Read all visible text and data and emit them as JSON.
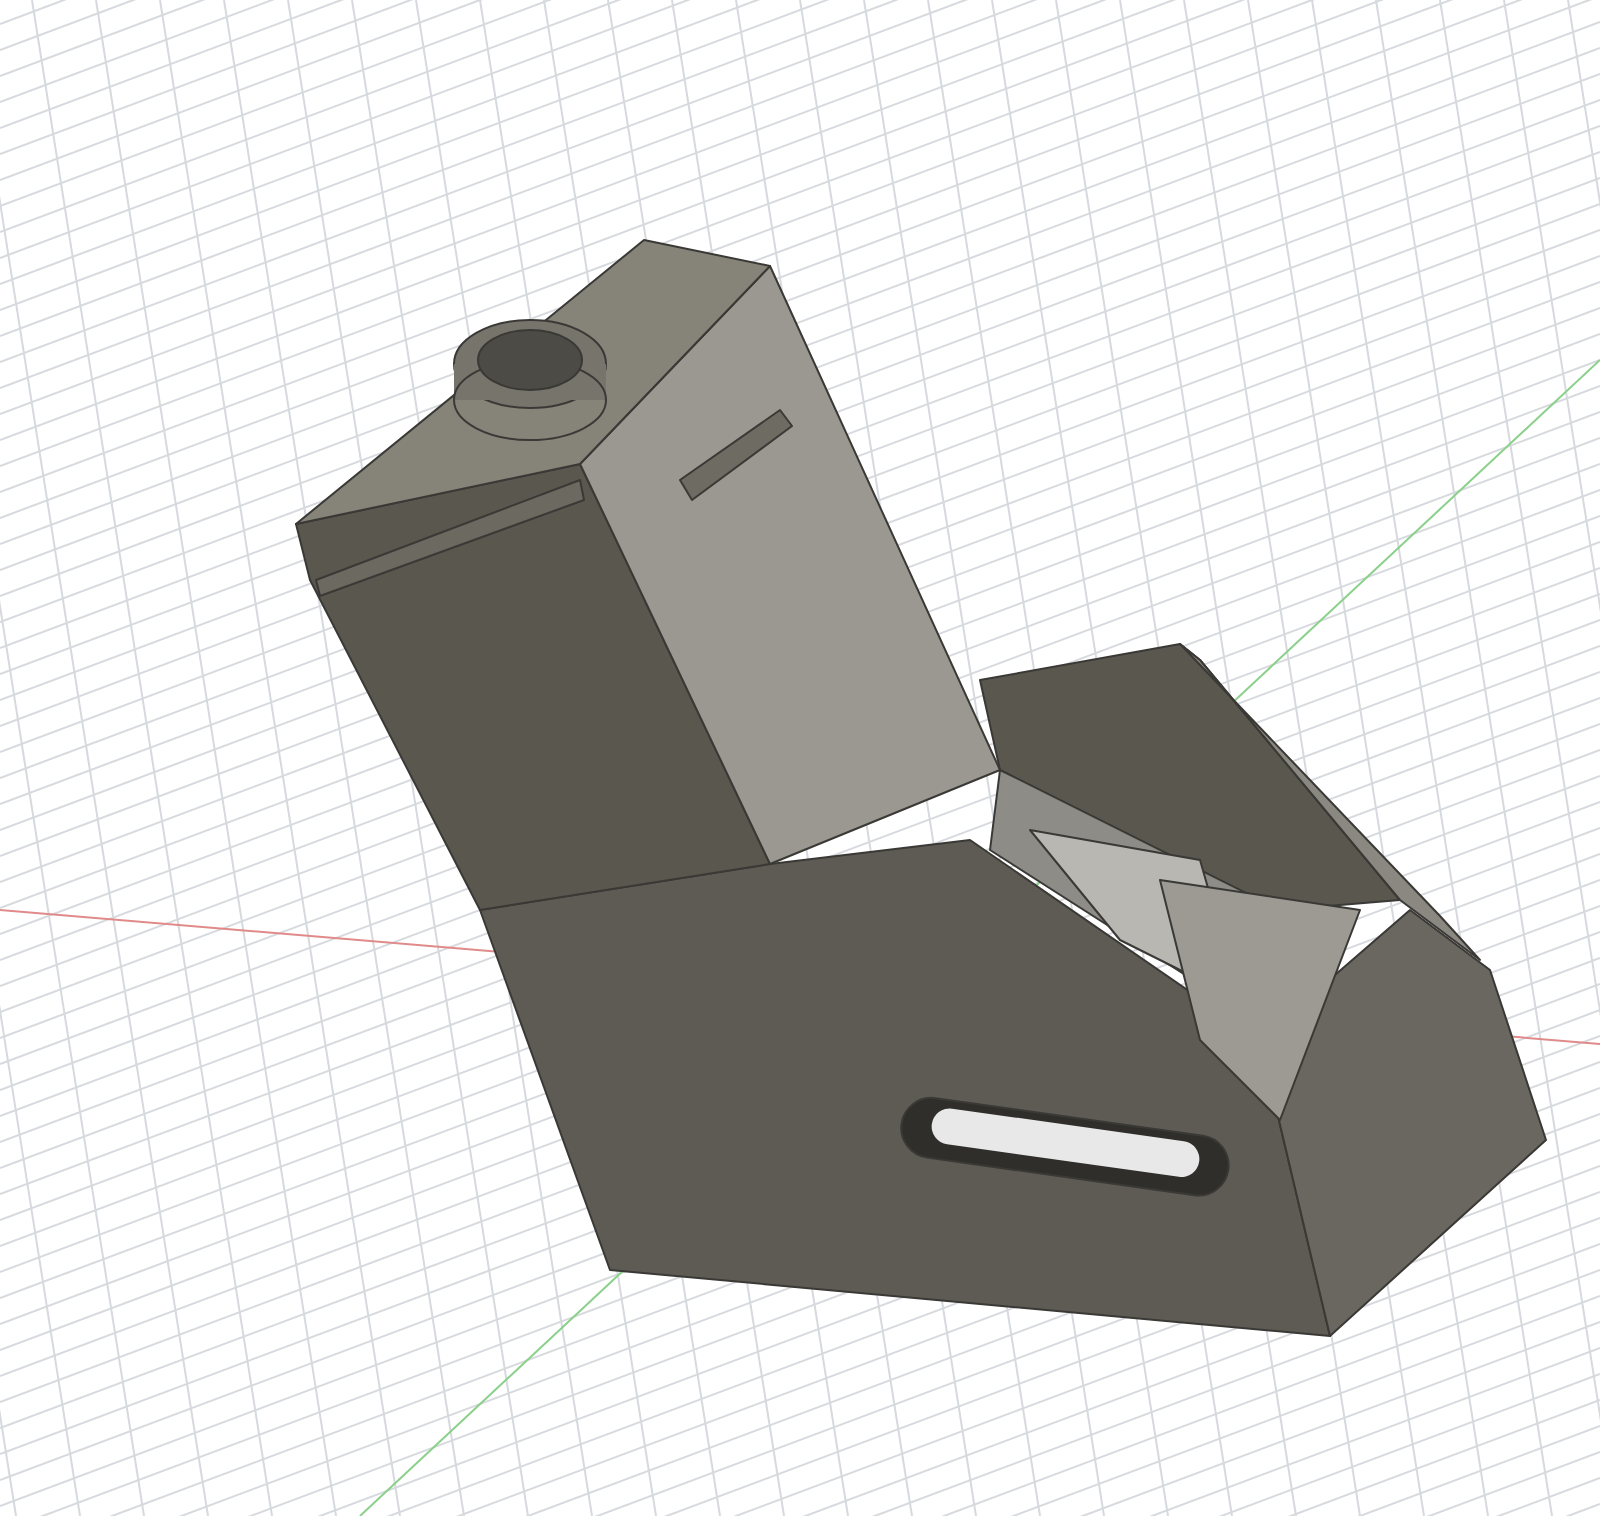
{
  "viewport": {
    "kind": "model"
  }
}
